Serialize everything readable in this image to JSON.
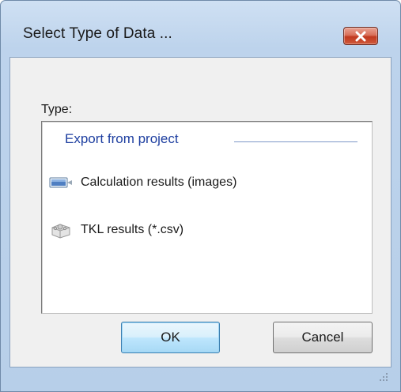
{
  "dialog": {
    "title": "Select Type of Data ...",
    "close_icon": "close-x-icon"
  },
  "type_label": "Type:",
  "list": {
    "group_header": "Export from project",
    "items": [
      {
        "label": "Calculation results (images)",
        "icon": "image-results-icon"
      },
      {
        "label": "TKL results (*.csv)",
        "icon": "gear-box-icon"
      }
    ]
  },
  "buttons": {
    "ok": "OK",
    "cancel": "Cancel"
  },
  "colors": {
    "accent": "#1e3fa0",
    "frame": "#bdd3ec",
    "close": "#c1391f"
  }
}
